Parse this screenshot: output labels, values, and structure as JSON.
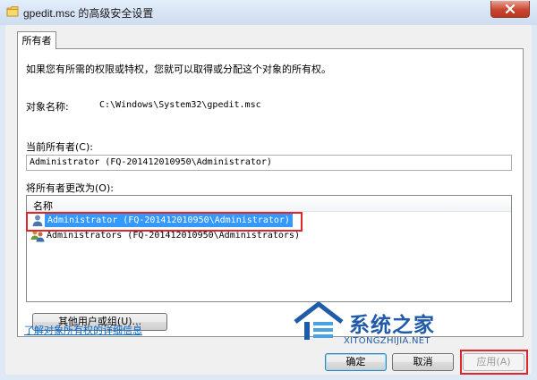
{
  "window": {
    "title": "gpedit.msc 的高级安全设置",
    "close_label": "✕"
  },
  "tab": {
    "label": "所有者"
  },
  "content": {
    "description": "如果您有所需的权限或特权，您就可以取得或分配这个对象的所有权。",
    "object_name_label": "对象名称:",
    "object_name_value": "C:\\Windows\\System32\\gpedit.msc",
    "current_owner_label": "当前所有者(C):",
    "current_owner_value": "Administrator (FQ-201412010950\\Administrator)",
    "change_owner_label": "将所有者更改为(O):",
    "list_header": "名称",
    "list_items": [
      {
        "label": "Administrator (FQ-201412010950\\Administrator)",
        "selected": true,
        "icon": "user-icon"
      },
      {
        "label": "Administrators (FQ-201412010950\\Administrators)",
        "selected": false,
        "icon": "group-icon"
      }
    ],
    "other_users_button": "其他用户或组(U)..."
  },
  "link": {
    "text": "了解对象所有权的详细信息"
  },
  "buttons": {
    "ok": "确定",
    "cancel": "取消",
    "apply": "应用(A)"
  },
  "watermark": {
    "title": "系统之家",
    "subtitle": "XITONGZHIJIA.NET"
  },
  "colors": {
    "selection": "#3399ff",
    "highlight_box": "#e0262a",
    "link": "#0066cc",
    "close": "#c9452f"
  }
}
